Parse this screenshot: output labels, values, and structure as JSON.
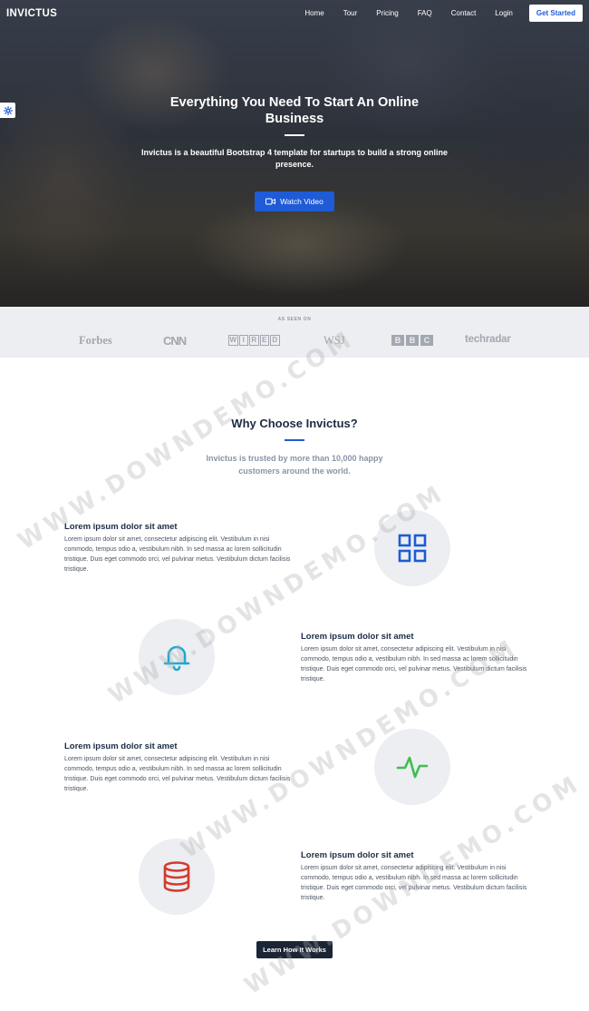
{
  "nav": {
    "brand": "INVICTUS",
    "links": [
      "Home",
      "Tour",
      "Pricing",
      "FAQ",
      "Contact",
      "Login"
    ],
    "cta": "Get Started"
  },
  "hero": {
    "title": "Everything You Need To Start An Online Business",
    "subtitle": "Invictus is a beautiful Bootstrap 4 template for startups to build a strong online presence.",
    "video_button": "Watch Video"
  },
  "seen_on": {
    "label": "AS SEEN ON",
    "logos": {
      "forbes": "Forbes",
      "cnn": "CNN",
      "wired": [
        "W",
        "I",
        "R",
        "E",
        "D"
      ],
      "wsj": "WSJ",
      "bbc": [
        "B",
        "B",
        "C"
      ],
      "techradar": "techradar"
    }
  },
  "why": {
    "title": "Why Choose Invictus?",
    "subtitle": "Invictus is trusted by more than 10,000 happy customers around the world."
  },
  "features": [
    {
      "title": "Lorem ipsum dolor sit amet",
      "text": "Lorem ipsum dolor sit amet, consectetur adipiscing elit. Vestibulum in nisi commodo, tempus odio a, vestibulum nibh. In sed massa ac lorem sollicitudin tristique. Duis eget commodo orci, vel pulvinar metus. Vestibulum dictum facilisis tristique.",
      "icon": "grid-icon",
      "color": "#1f5bd6"
    },
    {
      "title": "Lorem ipsum dolor sit amet",
      "text": "Lorem ipsum dolor sit amet, consectetur adipiscing elit. Vestibulum in nisi commodo, tempus odio a, vestibulum nibh. In sed massa ac lorem sollicitudin tristique. Duis eget commodo orci, vel pulvinar metus. Vestibulum dictum facilisis tristique.",
      "icon": "bell-icon",
      "color": "#1ba8d6"
    },
    {
      "title": "Lorem ipsum dolor sit amet",
      "text": "Lorem ipsum dolor sit amet, consectetur adipiscing elit. Vestibulum in nisi commodo, tempus odio a, vestibulum nibh. In sed massa ac lorem sollicitudin tristique. Duis eget commodo orci, vel pulvinar metus. Vestibulum dictum facilisis tristique.",
      "icon": "activity-icon",
      "color": "#3fbf4f"
    },
    {
      "title": "Lorem ipsum dolor sit amet",
      "text": "Lorem ipsum dolor sit amet, consectetur adipiscing elit. Vestibulum in nisi commodo, tempus odio a, vestibulum nibh. In sed massa ac lorem sollicitudin tristique. Duis eget commodo orci, vel pulvinar metus. Vestibulum dictum facilisis tristique.",
      "icon": "database-icon",
      "color": "#d33a2c"
    }
  ],
  "learn_button": "Learn How It Works",
  "watermark": "WWW.DOWNDEMO.COM"
}
